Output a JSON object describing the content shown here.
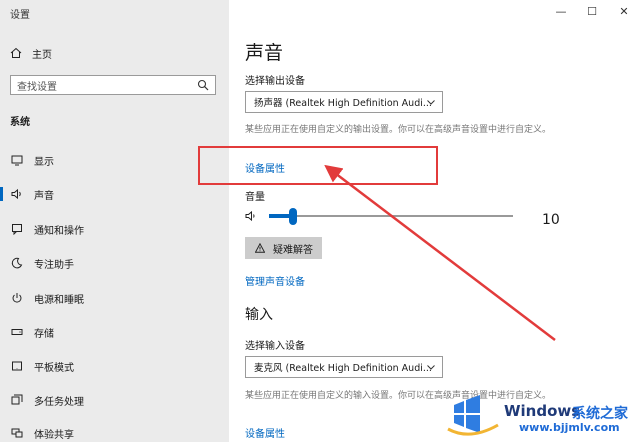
{
  "window": {
    "title": "设置",
    "controls": [
      "—",
      "☐",
      "✕"
    ]
  },
  "sidebar": {
    "home_label": "主页",
    "search_placeholder": "查找设置",
    "section_title": "系统",
    "items": [
      {
        "label": "显示",
        "icon": "monitor-icon"
      },
      {
        "label": "声音",
        "icon": "speaker-icon",
        "active": true
      },
      {
        "label": "通知和操作",
        "icon": "notification-icon"
      },
      {
        "label": "专注助手",
        "icon": "moon-icon"
      },
      {
        "label": "电源和睡眠",
        "icon": "power-icon"
      },
      {
        "label": "存储",
        "icon": "storage-icon"
      },
      {
        "label": "平板模式",
        "icon": "tablet-icon"
      },
      {
        "label": "多任务处理",
        "icon": "multitask-icon"
      },
      {
        "label": "体验共享",
        "icon": "share-icon"
      }
    ]
  },
  "main": {
    "title": "声音",
    "output": {
      "label": "选择输出设备",
      "device": "扬声器 (Realtek High Definition Audi...",
      "desc": "某些应用正在使用自定义的输出设置。你可以在高级声音设置中进行自定义。",
      "properties_link": "设备属性"
    },
    "volume": {
      "label": "音量",
      "value": "10",
      "level": 10
    },
    "troubleshoot_label": "疑难解答",
    "manage_link": "管理声音设备",
    "input": {
      "title": "输入",
      "label": "选择输入设备",
      "device": "麦克风 (Realtek High Definition Audi...",
      "desc": "某些应用正在使用自定义的输入设置。你可以在高级声音设置中进行自定义。",
      "properties_link": "设备属性"
    }
  },
  "annotation": {
    "color": "#e23b3b"
  },
  "watermark": {
    "brand": "Windows",
    "cn": "系统之家",
    "url": "www.bjjmlv.com"
  }
}
